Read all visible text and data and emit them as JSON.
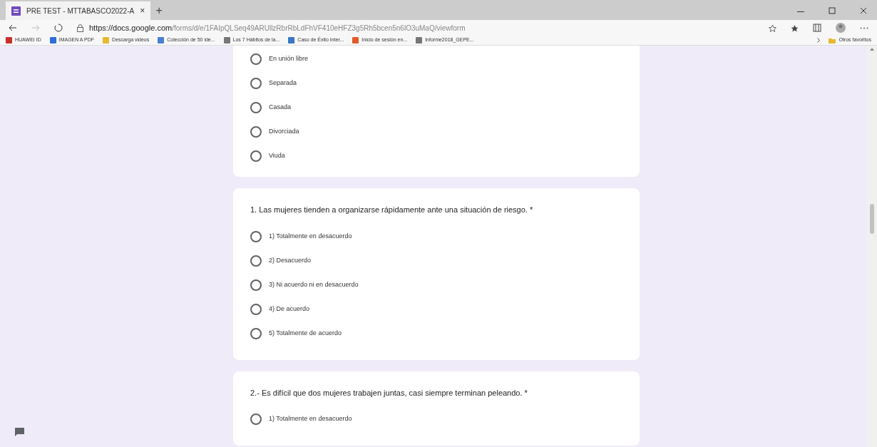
{
  "tab": {
    "title": "PRE TEST - MTTABASCO2022-A",
    "close": "×",
    "new_tab": "+"
  },
  "address_bar": {
    "url_host": "https://docs.google.com",
    "url_path": "/forms/d/e/1FAIpQLSeq49ARUllzRbrRbLdFhVF410eHFZ3g5Rh5bcen5n6lO3uMaQ/viewform"
  },
  "bookmarks": [
    "HUAWEI ID",
    "IMAGEN A PDF",
    "Descarga videos",
    "Colección de 50 ide...",
    "Los 7 Hábitos de la...",
    "Caso de Éxito Inter...",
    "Inicio de sesión en...",
    "Informe2018_GEPE..."
  ],
  "other_favorites": "Otros favoritos",
  "questions": [
    {
      "options": [
        {
          "label": "En unión libre",
          "selected": false
        },
        {
          "label": "Separada",
          "selected": false
        },
        {
          "label": "Casada",
          "selected": false
        },
        {
          "label": "Divorciada",
          "selected": false
        },
        {
          "label": "Viuda",
          "selected": false
        }
      ]
    },
    {
      "title": "1. Las mujeres tienden a organizarse rápidamente ante una situación de riesgo. *",
      "options": [
        {
          "label": "1) Totalmente en desacuerdo",
          "selected": false
        },
        {
          "label": "2) Desacuerdo",
          "selected": false
        },
        {
          "label": "3) Ni acuerdo ni en desacuerdo",
          "selected": false
        },
        {
          "label": "4) De acuerdo",
          "selected": false
        },
        {
          "label": "5) Totalmente de acuerdo",
          "selected": false
        }
      ]
    },
    {
      "title": "2.- Es difícil que dos mujeres trabajen juntas, casi siempre terminan peleando. *",
      "options": [
        {
          "label": "1) Totalmente en desacuerdo",
          "selected": false
        }
      ]
    }
  ]
}
